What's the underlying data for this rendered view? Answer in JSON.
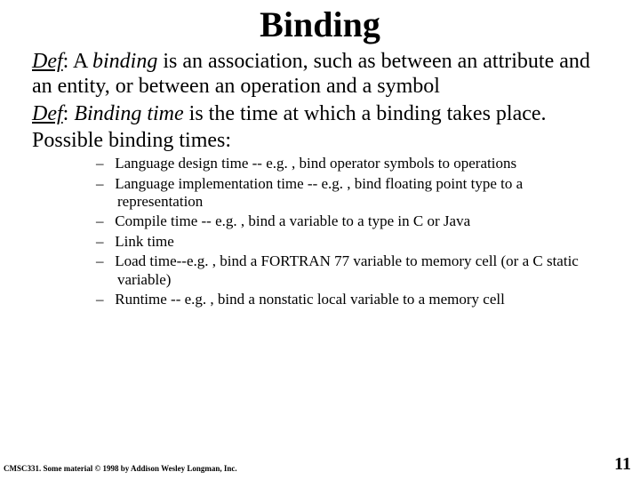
{
  "title": "Binding",
  "def1": {
    "label": "Def",
    "term": "binding",
    "before": ": A ",
    "after": " is an association, such as between an attribute and an entity, or between an operation and a symbol"
  },
  "def2": {
    "label": "Def",
    "term": "Binding time",
    "before": ": ",
    "after": " is the time at which a binding takes place."
  },
  "possible_label": "Possible binding times:",
  "bullets": [
    "Language design time -- e.g. , bind operator symbols to operations",
    "Language implementation time -- e.g. , bind floating point type to a representation",
    "Compile time -- e.g. , bind a variable to a type in C or Java",
    "Link time",
    "Load time--e.g. , bind a FORTRAN 77 variable to  memory cell (or a C static variable)",
    "Runtime -- e.g. , bind a nonstatic local variable to  a memory cell"
  ],
  "footer_left": "CMSC331.  Some material © 1998 by Addison Wesley Longman, Inc.",
  "page_number": "11"
}
